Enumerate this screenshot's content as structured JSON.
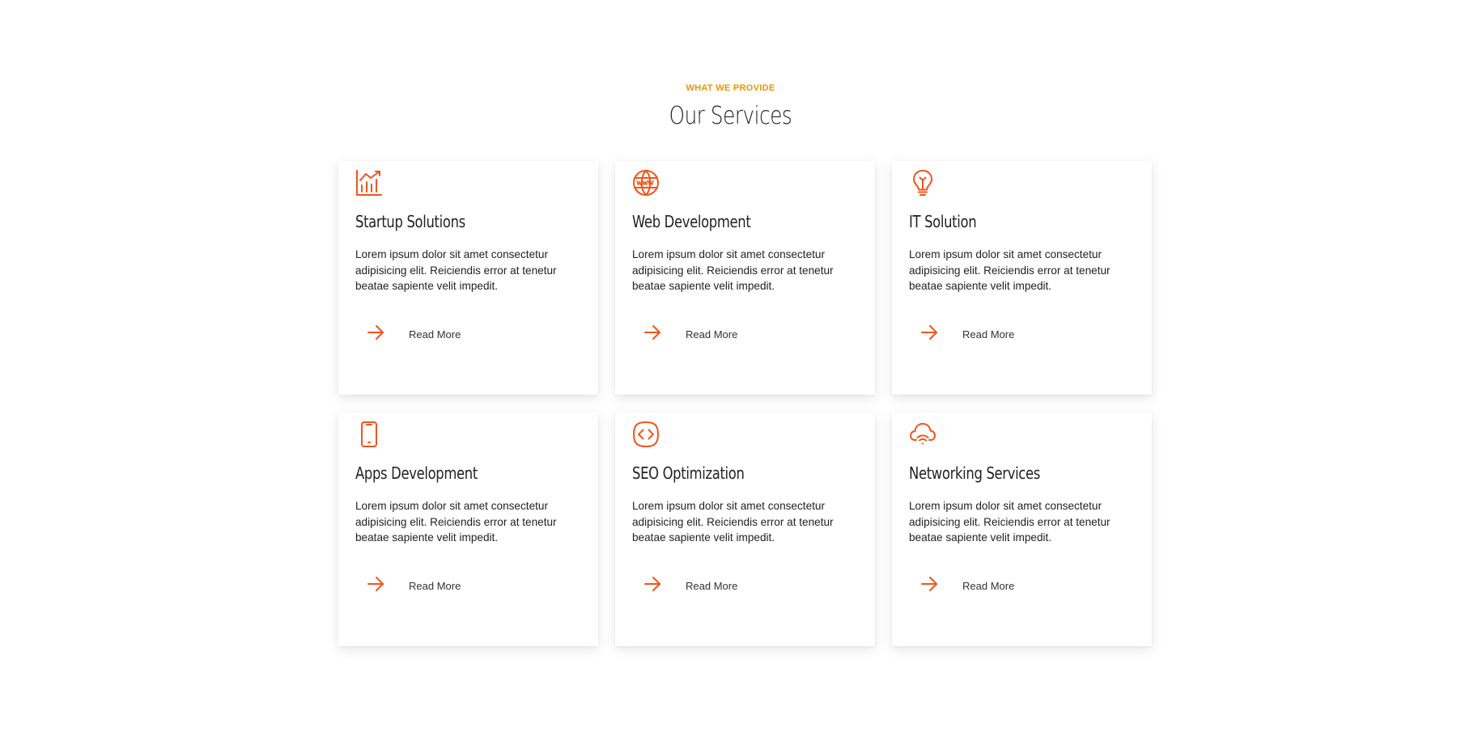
{
  "section": {
    "eyebrow": "WHAT WE PROVIDE",
    "heading": "Our Services"
  },
  "accent_color": "#f2541b",
  "eyebrow_color": "#f39200",
  "services": [
    {
      "icon": "chart-icon",
      "title": "Startup Solutions",
      "text": "Lorem ipsum dolor sit amet consectetur adipisicing elit. Reiciendis error at tenetur beatae sapiente velit impedit.",
      "link_label": "Read More"
    },
    {
      "icon": "globe-www-icon",
      "title": "Web Development",
      "text": "Lorem ipsum dolor sit amet consectetur adipisicing elit. Reiciendis error at tenetur beatae sapiente velit impedit.",
      "link_label": "Read More"
    },
    {
      "icon": "lightbulb-icon",
      "title": "IT Solution",
      "text": "Lorem ipsum dolor sit amet consectetur adipisicing elit. Reiciendis error at tenetur beatae sapiente velit impedit.",
      "link_label": "Read More"
    },
    {
      "icon": "smartphone-icon",
      "title": "Apps Development",
      "text": "Lorem ipsum dolor sit amet consectetur adipisicing elit. Reiciendis error at tenetur beatae sapiente velit impedit.",
      "link_label": "Read More"
    },
    {
      "icon": "code-icon",
      "title": "SEO Optimization",
      "text": "Lorem ipsum dolor sit amet consectetur adipisicing elit. Reiciendis error at tenetur beatae sapiente velit impedit.",
      "link_label": "Read More"
    },
    {
      "icon": "cloud-wifi-icon",
      "title": "Networking Services",
      "text": "Lorem ipsum dolor sit amet consectetur adipisicing elit. Reiciendis error at tenetur beatae sapiente velit impedit.",
      "link_label": "Read More"
    }
  ]
}
